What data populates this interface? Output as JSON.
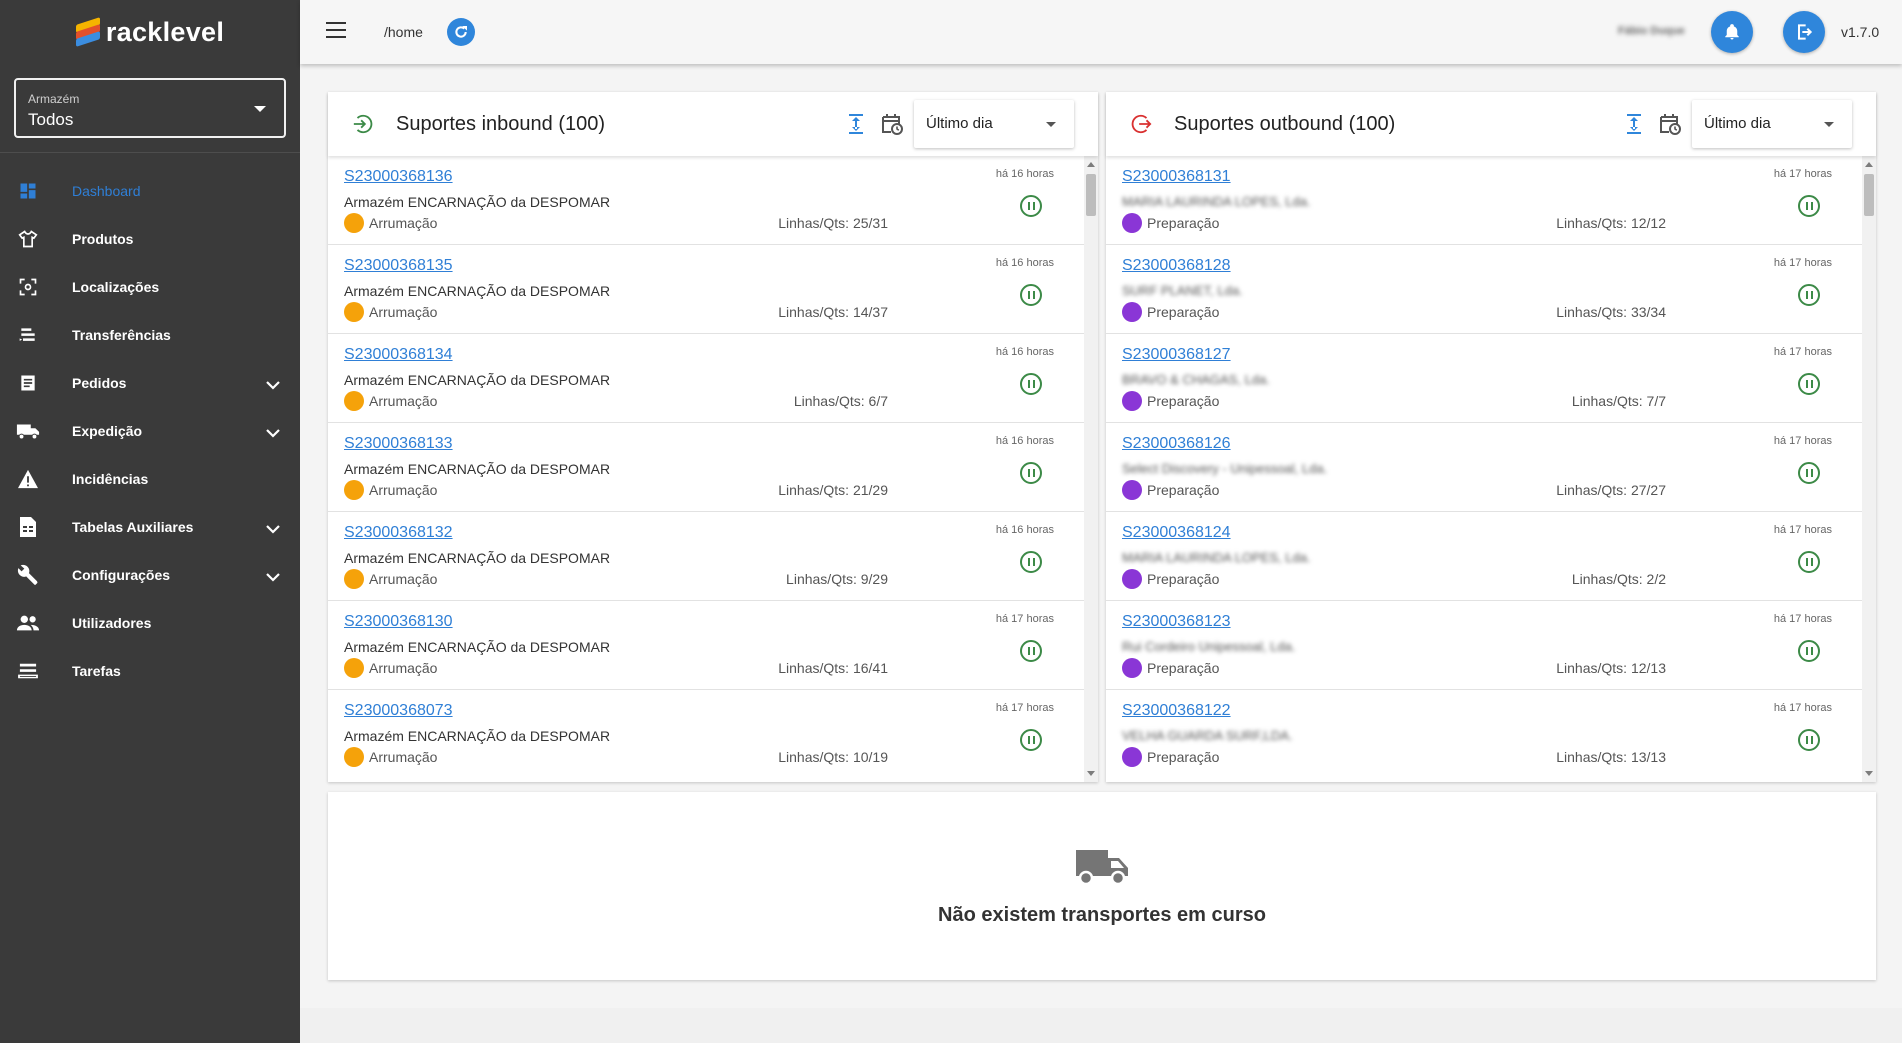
{
  "app": {
    "logo_text": "racklevel",
    "version": "v1.7.0",
    "route": "/home",
    "user_name": "Fábio Duque"
  },
  "warehouse": {
    "label": "Armazém",
    "value": "Todos"
  },
  "sidebar": {
    "items": [
      {
        "label": "Dashboard",
        "icon": "dashboard-icon",
        "active": true
      },
      {
        "label": "Produtos",
        "icon": "shirt-icon"
      },
      {
        "label": "Localizações",
        "icon": "location-target-icon"
      },
      {
        "label": "Transferências",
        "icon": "transfer-icon"
      },
      {
        "label": "Pedidos",
        "icon": "document-icon",
        "expandable": true
      },
      {
        "label": "Expedição",
        "icon": "truck-icon",
        "expandable": true
      },
      {
        "label": "Incidências",
        "icon": "warning-icon"
      },
      {
        "label": "Tabelas Auxiliares",
        "icon": "table-document-icon",
        "expandable": true
      },
      {
        "label": "Configurações",
        "icon": "wrench-icon",
        "expandable": true
      },
      {
        "label": "Utilizadores",
        "icon": "users-icon"
      },
      {
        "label": "Tarefas",
        "icon": "tasks-icon"
      }
    ]
  },
  "inbound": {
    "title": "Suportes inbound (100)",
    "period": "Último dia",
    "rows": [
      {
        "code": "S23000368136",
        "time": "há 16 horas",
        "desc": "Armazém ENCARNAÇÃO da DESPOMAR",
        "status": "Arrumação",
        "lines": "Linhas/Qts: 25/31"
      },
      {
        "code": "S23000368135",
        "time": "há 16 horas",
        "desc": "Armazém ENCARNAÇÃO da DESPOMAR",
        "status": "Arrumação",
        "lines": "Linhas/Qts: 14/37"
      },
      {
        "code": "S23000368134",
        "time": "há 16 horas",
        "desc": "Armazém ENCARNAÇÃO da DESPOMAR",
        "status": "Arrumação",
        "lines": "Linhas/Qts: 6/7"
      },
      {
        "code": "S23000368133",
        "time": "há 16 horas",
        "desc": "Armazém ENCARNAÇÃO da DESPOMAR",
        "status": "Arrumação",
        "lines": "Linhas/Qts: 21/29"
      },
      {
        "code": "S23000368132",
        "time": "há 16 horas",
        "desc": "Armazém ENCARNAÇÃO da DESPOMAR",
        "status": "Arrumação",
        "lines": "Linhas/Qts: 9/29"
      },
      {
        "code": "S23000368130",
        "time": "há 17 horas",
        "desc": "Armazém ENCARNAÇÃO da DESPOMAR",
        "status": "Arrumação",
        "lines": "Linhas/Qts: 16/41"
      },
      {
        "code": "S23000368073",
        "time": "há 17 horas",
        "desc": "Armazém ENCARNAÇÃO da DESPOMAR",
        "status": "Arrumação",
        "lines": "Linhas/Qts: 10/19"
      }
    ]
  },
  "outbound": {
    "title": "Suportes outbound (100)",
    "period": "Último dia",
    "rows": [
      {
        "code": "S23000368131",
        "time": "há 17 horas",
        "desc": "MARIA LAURINDA LOPES, Lda.",
        "status": "Preparação",
        "lines": "Linhas/Qts: 12/12"
      },
      {
        "code": "S23000368128",
        "time": "há 17 horas",
        "desc": "SURF PLANET, Lda.",
        "status": "Preparação",
        "lines": "Linhas/Qts: 33/34"
      },
      {
        "code": "S23000368127",
        "time": "há 17 horas",
        "desc": "BRAVO & CHAGAS, Lda.",
        "status": "Preparação",
        "lines": "Linhas/Qts: 7/7"
      },
      {
        "code": "S23000368126",
        "time": "há 17 horas",
        "desc": "Select Discovery - Unipessoal, Lda.",
        "status": "Preparação",
        "lines": "Linhas/Qts: 27/27"
      },
      {
        "code": "S23000368124",
        "time": "há 17 horas",
        "desc": "MARIA LAURINDA LOPES, Lda.",
        "status": "Preparação",
        "lines": "Linhas/Qts: 2/2"
      },
      {
        "code": "S23000368123",
        "time": "há 17 horas",
        "desc": "Rui Cordeiro Unipessoal, Lda.",
        "status": "Preparação",
        "lines": "Linhas/Qts: 12/13"
      },
      {
        "code": "S23000368122",
        "time": "há 17 horas",
        "desc": "VELHA GUARDA SURF,LDA.",
        "status": "Preparação",
        "lines": "Linhas/Qts: 13/13"
      }
    ]
  },
  "transports": {
    "empty_message": "Não existem transportes em curso"
  },
  "colors": {
    "accent": "#2f86db",
    "sidebar_bg": "#3a3a3a",
    "inbound_status": "#f5a20a",
    "outbound_status": "#8a36d6",
    "pause": "#3c8a47",
    "inbound_icon": "#3c8a47",
    "outbound_icon": "#d93030"
  }
}
